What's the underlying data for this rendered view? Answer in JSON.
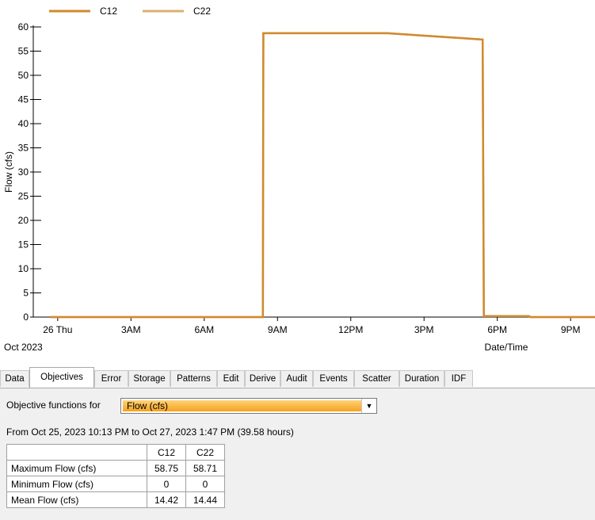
{
  "chart": {
    "legend": [
      {
        "name": "C12",
        "color": "#d08a2e"
      },
      {
        "name": "C22",
        "color": "#dcb070"
      }
    ],
    "ylabel": "Flow (cfs)",
    "xlabel": "Date/Time",
    "date_label": "Oct 2023",
    "y_ticks": [
      "0",
      "5",
      "10",
      "15",
      "20",
      "25",
      "30",
      "35",
      "40",
      "45",
      "50",
      "55",
      "60"
    ],
    "x_ticks": [
      "26 Thu",
      "3AM",
      "6AM",
      "9AM",
      "12PM",
      "3PM",
      "6PM",
      "9PM"
    ]
  },
  "chart_data": {
    "type": "line",
    "x_axis": "hours since Oct 26 00:00",
    "ylim": [
      0,
      60
    ],
    "xlim": [
      -1.0,
      22.0
    ],
    "series": [
      {
        "name": "C12",
        "color": "#d08a2e",
        "points": [
          [
            -0.3,
            0
          ],
          [
            8.4,
            0
          ],
          [
            8.42,
            58.7
          ],
          [
            13.5,
            58.7
          ],
          [
            15.0,
            58.2
          ],
          [
            16.5,
            57.7
          ],
          [
            17.4,
            57.4
          ],
          [
            17.45,
            0.2
          ],
          [
            19.3,
            0.2
          ],
          [
            19.35,
            0
          ],
          [
            22.0,
            0
          ]
        ]
      },
      {
        "name": "C22",
        "color": "#dcb070",
        "points": [
          [
            -0.3,
            0
          ],
          [
            8.4,
            0
          ],
          [
            8.42,
            58.7
          ],
          [
            13.5,
            58.7
          ],
          [
            15.0,
            58.2
          ],
          [
            16.5,
            57.7
          ],
          [
            17.4,
            57.4
          ],
          [
            17.45,
            0.2
          ],
          [
            19.3,
            0.2
          ],
          [
            19.35,
            0
          ],
          [
            22.0,
            0
          ]
        ]
      }
    ]
  },
  "tabs": [
    "Data",
    "Objectives",
    "Error",
    "Storage",
    "Patterns",
    "Edit",
    "Derive",
    "Audit",
    "Events",
    "Scatter",
    "Duration",
    "IDF"
  ],
  "active_tab": "Objectives",
  "objectives": {
    "label": "Objective functions for",
    "selected": "Flow (cfs)",
    "range_text": "From Oct 25, 2023 10:13 PM to Oct 27, 2023 1:47 PM (39.58 hours)",
    "columns": [
      "",
      "C12",
      "C22"
    ],
    "rows": [
      {
        "name": "Maximum Flow (cfs)",
        "values": [
          "58.75",
          "58.71"
        ]
      },
      {
        "name": "Minimum Flow (cfs)",
        "values": [
          "0",
          "0"
        ]
      },
      {
        "name": "Mean Flow (cfs)",
        "values": [
          "14.42",
          "14.44"
        ]
      }
    ]
  }
}
